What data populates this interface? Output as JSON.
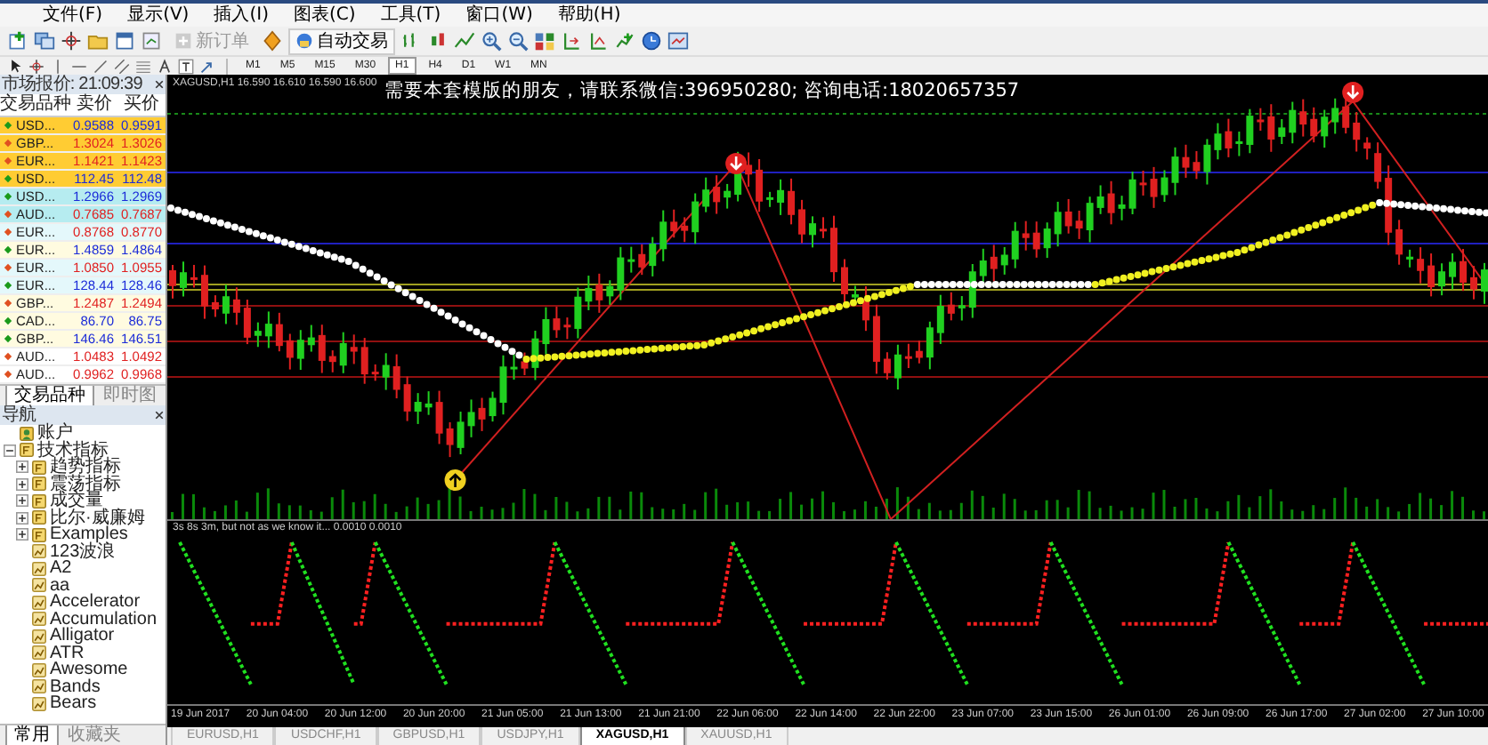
{
  "menu": [
    {
      "label": "文件(F)"
    },
    {
      "label": "显示(V)"
    },
    {
      "label": "插入(I)"
    },
    {
      "label": "图表(C)"
    },
    {
      "label": "工具(T)"
    },
    {
      "label": "窗口(W)"
    },
    {
      "label": "帮助(H)"
    }
  ],
  "toolbar": {
    "new_order": {
      "label": "新订单",
      "disabled": true
    },
    "auto_trading": {
      "label": "自动交易",
      "disabled": false
    }
  },
  "timeframes": [
    {
      "label": "M1",
      "selected": false
    },
    {
      "label": "M5",
      "selected": false
    },
    {
      "label": "M15",
      "selected": false
    },
    {
      "label": "M30",
      "selected": false
    },
    {
      "label": "H1",
      "selected": true
    },
    {
      "label": "H4",
      "selected": false
    },
    {
      "label": "D1",
      "selected": false
    },
    {
      "label": "W1",
      "selected": false
    },
    {
      "label": "MN",
      "selected": false
    }
  ],
  "market_watch": {
    "title": "市场报价: 21:09:39",
    "columns": [
      "交易品种",
      "卖价",
      "买价"
    ],
    "rows": [
      {
        "symbol": "USD...",
        "bid": "0.9588",
        "ask": "0.9591",
        "rising": true,
        "color": "#ffcc33"
      },
      {
        "symbol": "GBP...",
        "bid": "1.3024",
        "ask": "1.3026",
        "rising": false,
        "color": "#ffcc33"
      },
      {
        "symbol": "EUR...",
        "bid": "1.1421",
        "ask": "1.1423",
        "rising": false,
        "color": "#ffcc33"
      },
      {
        "symbol": "USD...",
        "bid": "112.45",
        "ask": "112.48",
        "rising": true,
        "color": "#ffcc33"
      },
      {
        "symbol": "USD...",
        "bid": "1.2966",
        "ask": "1.2969",
        "rising": true,
        "color": "#b6ecf0"
      },
      {
        "symbol": "AUD...",
        "bid": "0.7685",
        "ask": "0.7687",
        "rising": false,
        "color": "#b6ecf0"
      },
      {
        "symbol": "EUR...",
        "bid": "0.8768",
        "ask": "0.8770",
        "rising": false,
        "color": "#e4f8fb"
      },
      {
        "symbol": "EUR...",
        "bid": "1.4859",
        "ask": "1.4864",
        "rising": true,
        "color": "#fffbe0"
      },
      {
        "symbol": "EUR...",
        "bid": "1.0850",
        "ask": "1.0955",
        "rising": false,
        "color": "#e4f8fb"
      },
      {
        "symbol": "EUR...",
        "bid": "128.44",
        "ask": "128.46",
        "rising": true,
        "color": "#e4f8fb"
      },
      {
        "symbol": "GBP...",
        "bid": "1.2487",
        "ask": "1.2494",
        "rising": false,
        "color": "#fffbe0"
      },
      {
        "symbol": "CAD...",
        "bid": "86.70",
        "ask": "86.75",
        "rising": true,
        "color": "#fffbe0"
      },
      {
        "symbol": "GBP...",
        "bid": "146.46",
        "ask": "146.51",
        "rising": true,
        "color": "#fffbe0"
      },
      {
        "symbol": "AUD...",
        "bid": "1.0483",
        "ask": "1.0492",
        "rising": false,
        "color": "#ffffff"
      },
      {
        "symbol": "AUD...",
        "bid": "0.9962",
        "ask": "0.9968",
        "rising": false,
        "color": "#ffffff"
      }
    ],
    "tabs": [
      {
        "label": "交易品种",
        "selected": true
      },
      {
        "label": "即时图",
        "selected": false
      }
    ]
  },
  "navigator": {
    "title": "导航",
    "tree": [
      {
        "label": "账户",
        "kind": "account"
      },
      {
        "label": "技术指标",
        "kind": "folder",
        "expanded": true,
        "children": [
          {
            "label": "趋势指标",
            "kind": "folder",
            "expanded": false
          },
          {
            "label": "震荡指标",
            "kind": "folder",
            "expanded": false
          },
          {
            "label": "成交量",
            "kind": "folder",
            "expanded": false
          },
          {
            "label": "比尔·威廉姆",
            "kind": "folder",
            "expanded": false
          },
          {
            "label": "Examples",
            "kind": "folder",
            "expanded": false
          },
          {
            "label": "123波浪",
            "kind": "indicator"
          },
          {
            "label": "A2",
            "kind": "indicator"
          },
          {
            "label": "aa",
            "kind": "indicator"
          },
          {
            "label": "Accelerator",
            "kind": "indicator"
          },
          {
            "label": "Accumulation",
            "kind": "indicator"
          },
          {
            "label": "Alligator",
            "kind": "indicator"
          },
          {
            "label": "ATR",
            "kind": "indicator"
          },
          {
            "label": "Awesome",
            "kind": "indicator"
          },
          {
            "label": "Bands",
            "kind": "indicator"
          },
          {
            "label": "Bears",
            "kind": "indicator"
          }
        ]
      }
    ],
    "tabs": [
      {
        "label": "常用",
        "selected": true
      },
      {
        "label": "收藏夹",
        "selected": false
      }
    ]
  },
  "chart": {
    "header": "XAGUSD,H1  16.590 16.610 16.590 16.600",
    "notice": "需要本套模版的朋友，请联系微信:396950280; 咨询电话:18020657357",
    "indicator_label": "3s 8s 3m, but not as we know it...  0.0010 0.0010",
    "time_axis": [
      "19 Jun 2017",
      "20 Jun 04:00",
      "20 Jun 12:00",
      "20 Jun 20:00",
      "21 Jun 05:00",
      "21 Jun 13:00",
      "21 Jun 21:00",
      "22 Jun 06:00",
      "22 Jun 14:00",
      "22 Jun 22:00",
      "23 Jun 07:00",
      "23 Jun 15:00",
      "26 Jun 01:00",
      "26 Jun 09:00",
      "26 Jun 17:00",
      "27 Jun 02:00",
      "27 Jun 10:00"
    ]
  },
  "chart_tabs": [
    {
      "label": "EURUSD,H1",
      "selected": false
    },
    {
      "label": "USDCHF,H1",
      "selected": false
    },
    {
      "label": "GBPUSD,H1",
      "selected": false
    },
    {
      "label": "USDJPY,H1",
      "selected": false
    },
    {
      "label": "XAGUSD,H1",
      "selected": true
    },
    {
      "label": "XAUUSD,H1",
      "selected": false
    }
  ]
}
